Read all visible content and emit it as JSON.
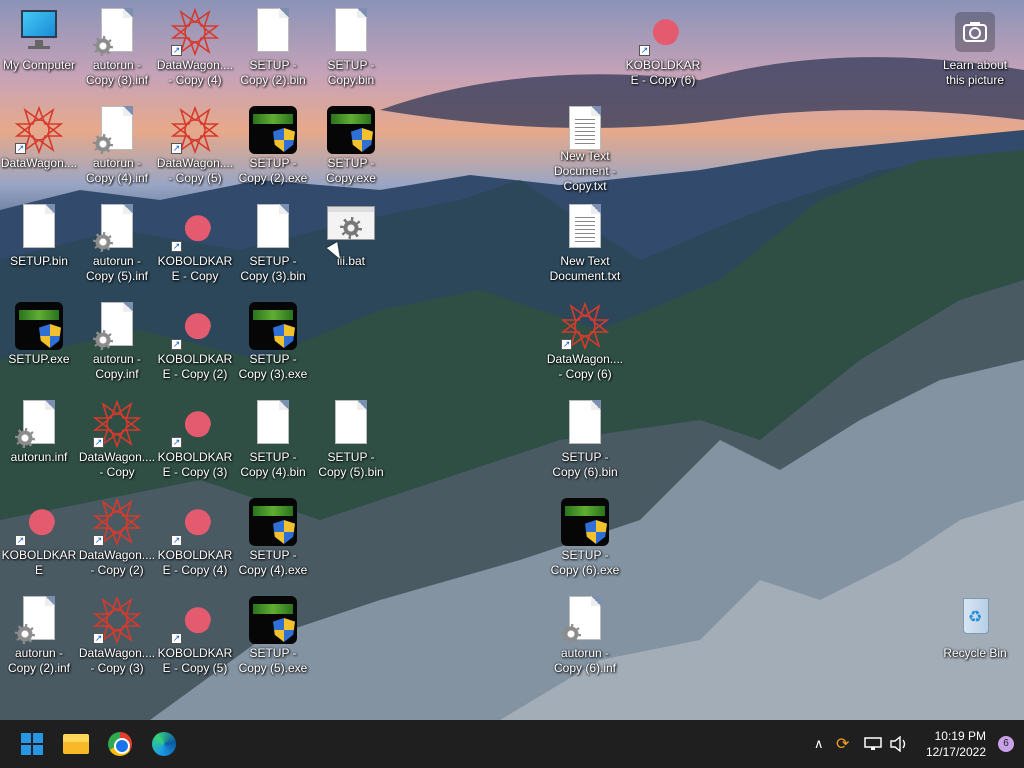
{
  "desktop": {
    "icons": [
      {
        "label": "My Computer",
        "type": "pc"
      },
      {
        "label": "autorun - Copy (3).inf",
        "type": "inf"
      },
      {
        "label": "DataWagon.... - Copy (4)",
        "type": "star"
      },
      {
        "label": "SETUP - Copy (2).bin",
        "type": "bin"
      },
      {
        "label": "SETUP - Copy.bin",
        "type": "bin"
      },
      {
        "label": "KOBOLDKARE - Copy (6)",
        "type": "kobold"
      },
      {
        "label": "Learn about this picture",
        "type": "camera"
      },
      {
        "label": "DataWagon....",
        "type": "star"
      },
      {
        "label": "autorun - Copy (4).inf",
        "type": "inf"
      },
      {
        "label": "DataWagon.... - Copy (5)",
        "type": "star"
      },
      {
        "label": "SETUP - Copy (2).exe",
        "type": "setup"
      },
      {
        "label": "SETUP - Copy.exe",
        "type": "setup"
      },
      {
        "label": "New Text Document - Copy.txt",
        "type": "txt"
      },
      {
        "label": "SETUP.bin",
        "type": "bin"
      },
      {
        "label": "autorun - Copy (5).inf",
        "type": "inf"
      },
      {
        "label": "KOBOLDKARE - Copy",
        "type": "kobold"
      },
      {
        "label": "SETUP - Copy (3).bin",
        "type": "bin"
      },
      {
        "label": "iii.bat",
        "type": "bat"
      },
      {
        "label": "New Text Document.txt",
        "type": "txt"
      },
      {
        "label": "SETUP.exe",
        "type": "setup"
      },
      {
        "label": "autorun - Copy.inf",
        "type": "inf"
      },
      {
        "label": "KOBOLDKARE - Copy (2)",
        "type": "kobold"
      },
      {
        "label": "SETUP - Copy (3).exe",
        "type": "setup"
      },
      {
        "label": "DataWagon.... - Copy (6)",
        "type": "star"
      },
      {
        "label": "autorun.inf",
        "type": "inf"
      },
      {
        "label": "DataWagon.... - Copy",
        "type": "star"
      },
      {
        "label": "KOBOLDKARE - Copy (3)",
        "type": "kobold"
      },
      {
        "label": "SETUP - Copy (4).bin",
        "type": "bin"
      },
      {
        "label": "SETUP - Copy (5).bin",
        "type": "bin"
      },
      {
        "label": "SETUP - Copy (6).bin",
        "type": "bin"
      },
      {
        "label": "KOBOLDKARE",
        "type": "kobold"
      },
      {
        "label": "DataWagon.... - Copy (2)",
        "type": "star"
      },
      {
        "label": "KOBOLDKARE - Copy (4)",
        "type": "kobold"
      },
      {
        "label": "SETUP - Copy (4).exe",
        "type": "setup"
      },
      {
        "label": "SETUP - Copy (6).exe",
        "type": "setup"
      },
      {
        "label": "autorun - Copy (2).inf",
        "type": "inf"
      },
      {
        "label": "DataWagon.... - Copy (3)",
        "type": "star"
      },
      {
        "label": "KOBOLDKARE - Copy (5)",
        "type": "kobold"
      },
      {
        "label": "SETUP - Copy (5).exe",
        "type": "setup"
      },
      {
        "label": "autorun - Copy (6).inf",
        "type": "inf"
      },
      {
        "label": "Recycle Bin",
        "type": "recycle"
      }
    ]
  },
  "taskbar": {
    "apps": [
      "start-icon",
      "file-explorer-icon",
      "chrome-icon",
      "edge-icon"
    ],
    "clock": {
      "time": "10:19 PM",
      "date": "12/17/2022"
    },
    "notifications": "6"
  },
  "colors": {
    "taskbar": "#1f1f1f",
    "accent": "#2a97e6"
  }
}
